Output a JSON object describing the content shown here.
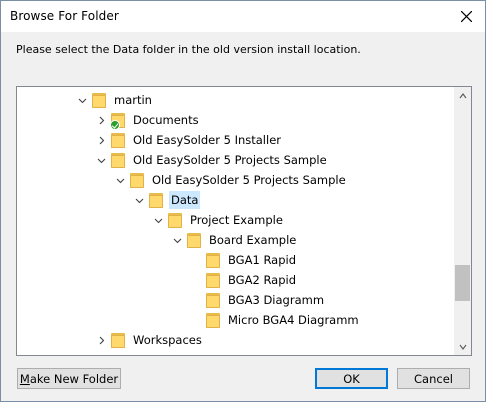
{
  "window": {
    "title": "Browse For Folder"
  },
  "instruction": "Please select the Data folder in the old version install location.",
  "tree": [
    {
      "label": "martin",
      "expander": "expanded",
      "icon": "folder-icon"
    },
    {
      "label": "Documents",
      "expander": "collapsed",
      "icon": "documents-folder-icon"
    },
    {
      "label": "Old EasySolder 5 Installer",
      "expander": "collapsed",
      "icon": "folder-icon"
    },
    {
      "label": "Old EasySolder 5 Projects Sample",
      "expander": "expanded",
      "icon": "folder-icon"
    },
    {
      "label": "Old EasySolder 5 Projects Sample",
      "expander": "expanded",
      "icon": "folder-icon"
    },
    {
      "label": "Data",
      "expander": "expanded",
      "icon": "folder-icon",
      "selected": true
    },
    {
      "label": "Project Example",
      "expander": "expanded",
      "icon": "folder-icon"
    },
    {
      "label": "Board Example",
      "expander": "expanded",
      "icon": "folder-icon"
    },
    {
      "label": "BGA1 Rapid",
      "expander": "none",
      "icon": "folder-icon"
    },
    {
      "label": "BGA2 Rapid",
      "expander": "none",
      "icon": "folder-icon"
    },
    {
      "label": "BGA3 Diagramm",
      "expander": "none",
      "icon": "folder-icon"
    },
    {
      "label": "Micro BGA4 Diagramm",
      "expander": "none",
      "icon": "folder-icon"
    },
    {
      "label": "Workspaces",
      "expander": "collapsed",
      "icon": "folder-icon"
    }
  ],
  "buttons": {
    "make_new_folder_mnemonic": "M",
    "make_new_folder_rest": "ake New Folder",
    "ok": "OK",
    "cancel": "Cancel"
  },
  "colors": {
    "selection": "#cce8ff",
    "folder": "#ffd96b",
    "accent": "#0078d7"
  }
}
